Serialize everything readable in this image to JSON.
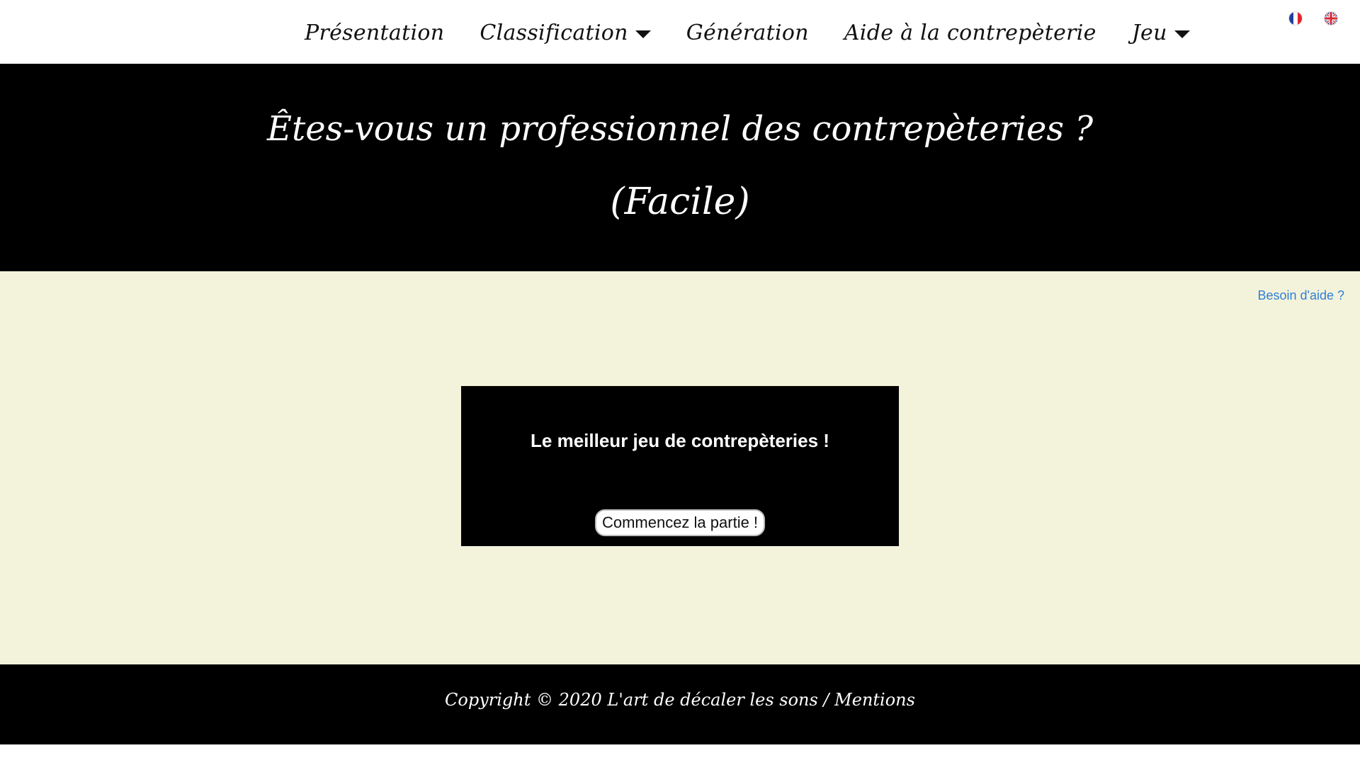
{
  "nav": {
    "items": [
      {
        "label": "Présentation",
        "dropdown": false
      },
      {
        "label": "Classification",
        "dropdown": true
      },
      {
        "label": "Génération",
        "dropdown": false
      },
      {
        "label": "Aide à la contrepèterie",
        "dropdown": false
      },
      {
        "label": "Jeu",
        "dropdown": true
      }
    ],
    "languages": [
      {
        "icon": "french-flag-icon",
        "code": "fr"
      },
      {
        "icon": "uk-flag-icon",
        "code": "en"
      }
    ]
  },
  "hero": {
    "title": "Êtes-vous un professionnel des contrepèteries ?",
    "subtitle": "(Facile)"
  },
  "main": {
    "help_link": "Besoin d'aide ?",
    "game_heading": "Le meilleur jeu de contrepèteries !",
    "start_button": "Commencez la partie !"
  },
  "footer": {
    "copyright": "Copyright © 2020 L'art de décaler les sons /",
    "mentions": "Mentions"
  },
  "colors": {
    "main_background": "#f3f3dc",
    "hero_background": "#000000",
    "link": "#2f7fd6"
  }
}
